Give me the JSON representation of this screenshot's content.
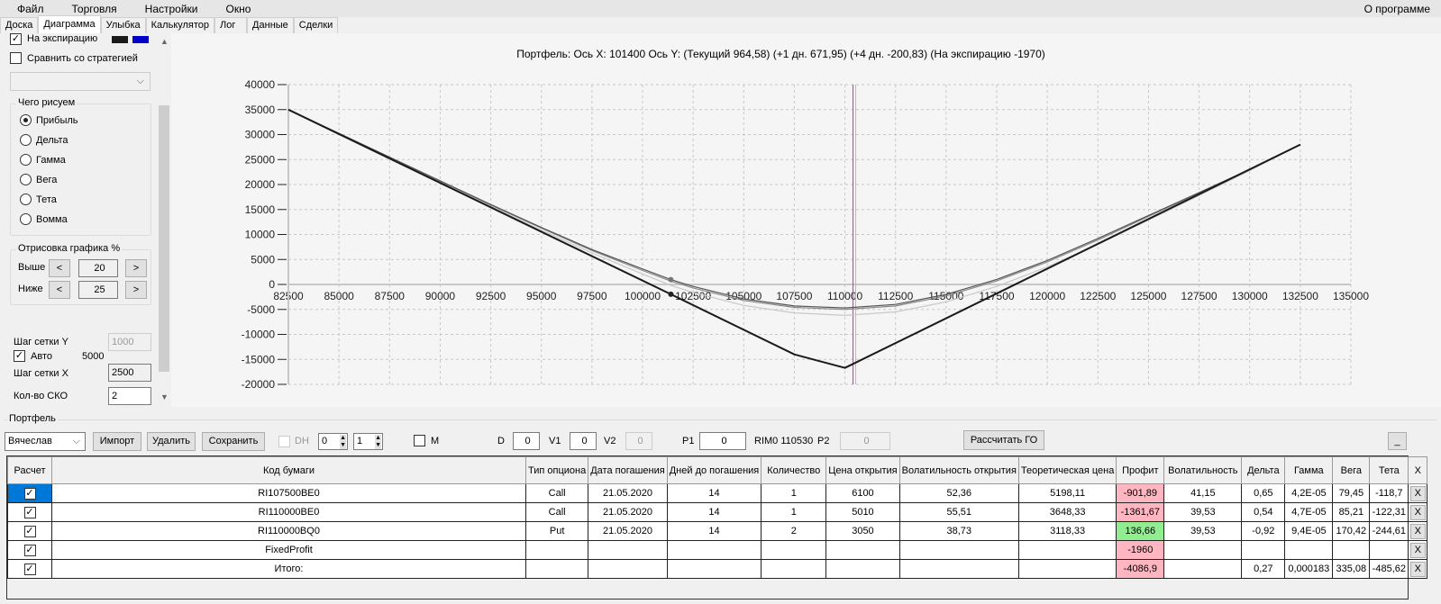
{
  "menu": {
    "items": [
      "Файл",
      "Торговля",
      "Настройки",
      "Окно"
    ],
    "about": "О программе"
  },
  "tabs": [
    "Доска",
    "Диаграмма",
    "Улыбка",
    "Калькулятор",
    "Лог",
    "Данные",
    "Сделки"
  ],
  "active_tab": "Диаграмма",
  "left": {
    "expiration_label": "На экспирацию",
    "expiration_checked": true,
    "swatch_colors": [
      "#1a1a1a",
      "#0000c8"
    ],
    "compare_label": "Сравнить со стратегией",
    "compare_checked": false,
    "strategy_select": "",
    "draw_group": "Чего рисуем",
    "draw_options": [
      "Прибыль",
      "Дельта",
      "Гамма",
      "Вега",
      "Тета",
      "Вомма"
    ],
    "draw_selected": "Прибыль",
    "range_group": "Отрисовка графика %",
    "above_label": "Выше",
    "above_value": "20",
    "below_label": "Ниже",
    "below_value": "25",
    "prev": "<",
    "next": ">",
    "grid_y_label": "Шаг сетки Y",
    "grid_y_value": "1000",
    "auto_label": "Авто",
    "auto_checked": true,
    "auto_value": "5000",
    "grid_x_label": "Шаг сетки X",
    "grid_x_value": "2500",
    "sko_label": "Кол-во СКО",
    "sko_value": "2"
  },
  "chart_data": {
    "type": "line",
    "title": "Портфель: Ось X: 101400 Ось Y:  (Текущий 964,58)  (+1 дн. 671,95)  (+4 дн. -200,83)  (На экспирацию -1970)",
    "xlim": [
      82500,
      135000
    ],
    "ylim": [
      -20000,
      40000
    ],
    "xticks": [
      82500,
      85000,
      87500,
      90000,
      92500,
      95000,
      97500,
      100000,
      102500,
      105000,
      107500,
      110000,
      112500,
      115000,
      117500,
      120000,
      122500,
      125000,
      127500,
      130000,
      132500,
      135000
    ],
    "yticks": [
      -20000,
      -15000,
      -10000,
      -5000,
      0,
      5000,
      10000,
      15000,
      20000,
      25000,
      30000,
      35000,
      40000
    ],
    "grid": true,
    "cursor_x": 101400,
    "price_lines": [
      110400,
      110530
    ],
    "series": [
      {
        "color": "#1a1a1a",
        "points": [
          [
            82500,
            35000
          ],
          [
            101400,
            -1970
          ],
          [
            107500,
            -14000
          ],
          [
            110000,
            -16700
          ],
          [
            132500,
            28000
          ]
        ]
      },
      {
        "color": "#555555",
        "points": [
          [
            82500,
            35000
          ],
          [
            87500,
            25500
          ],
          [
            92500,
            16000
          ],
          [
            95000,
            11400
          ],
          [
            97500,
            7000
          ],
          [
            100000,
            3100
          ],
          [
            101400,
            965
          ],
          [
            102500,
            -400
          ],
          [
            105000,
            -2900
          ],
          [
            107500,
            -4300
          ],
          [
            110000,
            -4700
          ],
          [
            112500,
            -4000
          ],
          [
            115000,
            -2000
          ],
          [
            117500,
            1000
          ],
          [
            120000,
            4800
          ],
          [
            122500,
            9200
          ],
          [
            125000,
            13800
          ],
          [
            127500,
            18400
          ],
          [
            130000,
            23000
          ],
          [
            132500,
            28000
          ]
        ]
      },
      {
        "color": "#888888",
        "points": [
          [
            82500,
            35000
          ],
          [
            87500,
            25400
          ],
          [
            92500,
            15900
          ],
          [
            95000,
            11300
          ],
          [
            97500,
            6800
          ],
          [
            100000,
            2800
          ],
          [
            101400,
            672
          ],
          [
            102500,
            -700
          ],
          [
            105000,
            -3200
          ],
          [
            107500,
            -4600
          ],
          [
            110000,
            -5000
          ],
          [
            112500,
            -4300
          ],
          [
            115000,
            -2300
          ],
          [
            117500,
            700
          ],
          [
            120000,
            4500
          ],
          [
            122500,
            8900
          ],
          [
            125000,
            13600
          ],
          [
            127500,
            18300
          ],
          [
            130000,
            23000
          ],
          [
            132500,
            28000
          ]
        ]
      },
      {
        "color": "#c8c8c8",
        "points": [
          [
            82500,
            35000
          ],
          [
            87500,
            25200
          ],
          [
            92500,
            15600
          ],
          [
            95000,
            10900
          ],
          [
            97500,
            6300
          ],
          [
            100000,
            2100
          ],
          [
            101400,
            -200
          ],
          [
            102500,
            -1600
          ],
          [
            105000,
            -4200
          ],
          [
            107500,
            -5700
          ],
          [
            110000,
            -6200
          ],
          [
            112500,
            -5500
          ],
          [
            115000,
            -3500
          ],
          [
            117500,
            -400
          ],
          [
            120000,
            3500
          ],
          [
            122500,
            8000
          ],
          [
            125000,
            12900
          ],
          [
            127500,
            17800
          ],
          [
            130000,
            22800
          ],
          [
            132500,
            28000
          ]
        ]
      }
    ]
  },
  "portfolio": {
    "group": "Портфель",
    "user": "Вячеслав",
    "import": "Импорт",
    "delete": "Удалить",
    "save": "Сохранить",
    "dh_label": "DH",
    "spin1": "0",
    "spin2": "1",
    "m_label": "M",
    "d_label": "D",
    "d_value": "0",
    "v1_label": "V1",
    "v1_value": "0",
    "v2_label": "V2",
    "v2_value": "0",
    "p1_label": "P1",
    "p1_value": "0",
    "instrument": "RIM0 110530",
    "p2_label": "P2",
    "p2_value": "0",
    "calc_go": "Рассчитать ГО",
    "minimize": "_",
    "columns": [
      "Расчет",
      "Код бумаги",
      "Тип опциона",
      "Дата погашения",
      "Дней до погашения",
      "Количество",
      "Цена открытия",
      "Волатильность открытия",
      "Теоретическая цена",
      "Профит",
      "Волатильность",
      "Дельта",
      "Гамма",
      "Вега",
      "Тета",
      "X"
    ],
    "rows": [
      {
        "code": "RI107500BE0",
        "type": "Call",
        "date": "21.05.2020",
        "days": "14",
        "qty": "1",
        "price": "6100",
        "vol_open": "52,36",
        "theor": "5198,11",
        "profit": "-901,89",
        "vol": "41,15",
        "delta": "0,65",
        "gamma": "4,2E-05",
        "vega": "79,45",
        "theta": "-118,7"
      },
      {
        "code": "RI110000BE0",
        "type": "Call",
        "date": "21.05.2020",
        "days": "14",
        "qty": "1",
        "price": "5010",
        "vol_open": "55,51",
        "theor": "3648,33",
        "profit": "-1361,67",
        "vol": "39,53",
        "delta": "0,54",
        "gamma": "4,7E-05",
        "vega": "85,21",
        "theta": "-122,31"
      },
      {
        "code": "RI110000BQ0",
        "type": "Put",
        "date": "21.05.2020",
        "days": "14",
        "qty": "2",
        "price": "3050",
        "vol_open": "38,73",
        "theor": "3118,33",
        "profit": "136,66",
        "vol": "39,53",
        "delta": "-0,92",
        "gamma": "9,4E-05",
        "vega": "170,42",
        "theta": "-244,61"
      },
      {
        "code": "FixedProfit",
        "type": "",
        "date": "",
        "days": "",
        "qty": "",
        "price": "",
        "vol_open": "",
        "theor": "",
        "profit": "-1960",
        "vol": "",
        "delta": "",
        "gamma": "",
        "vega": "",
        "theta": ""
      },
      {
        "code": "Итого:",
        "type": "",
        "date": "",
        "days": "",
        "qty": "",
        "price": "",
        "vol_open": "",
        "theor": "",
        "profit": "-4086,9",
        "vol": "",
        "delta": "0,27",
        "gamma": "0,000183",
        "vega": "335,08",
        "theta": "-485,62"
      }
    ],
    "check_mark": "✓",
    "x_label": "X"
  }
}
